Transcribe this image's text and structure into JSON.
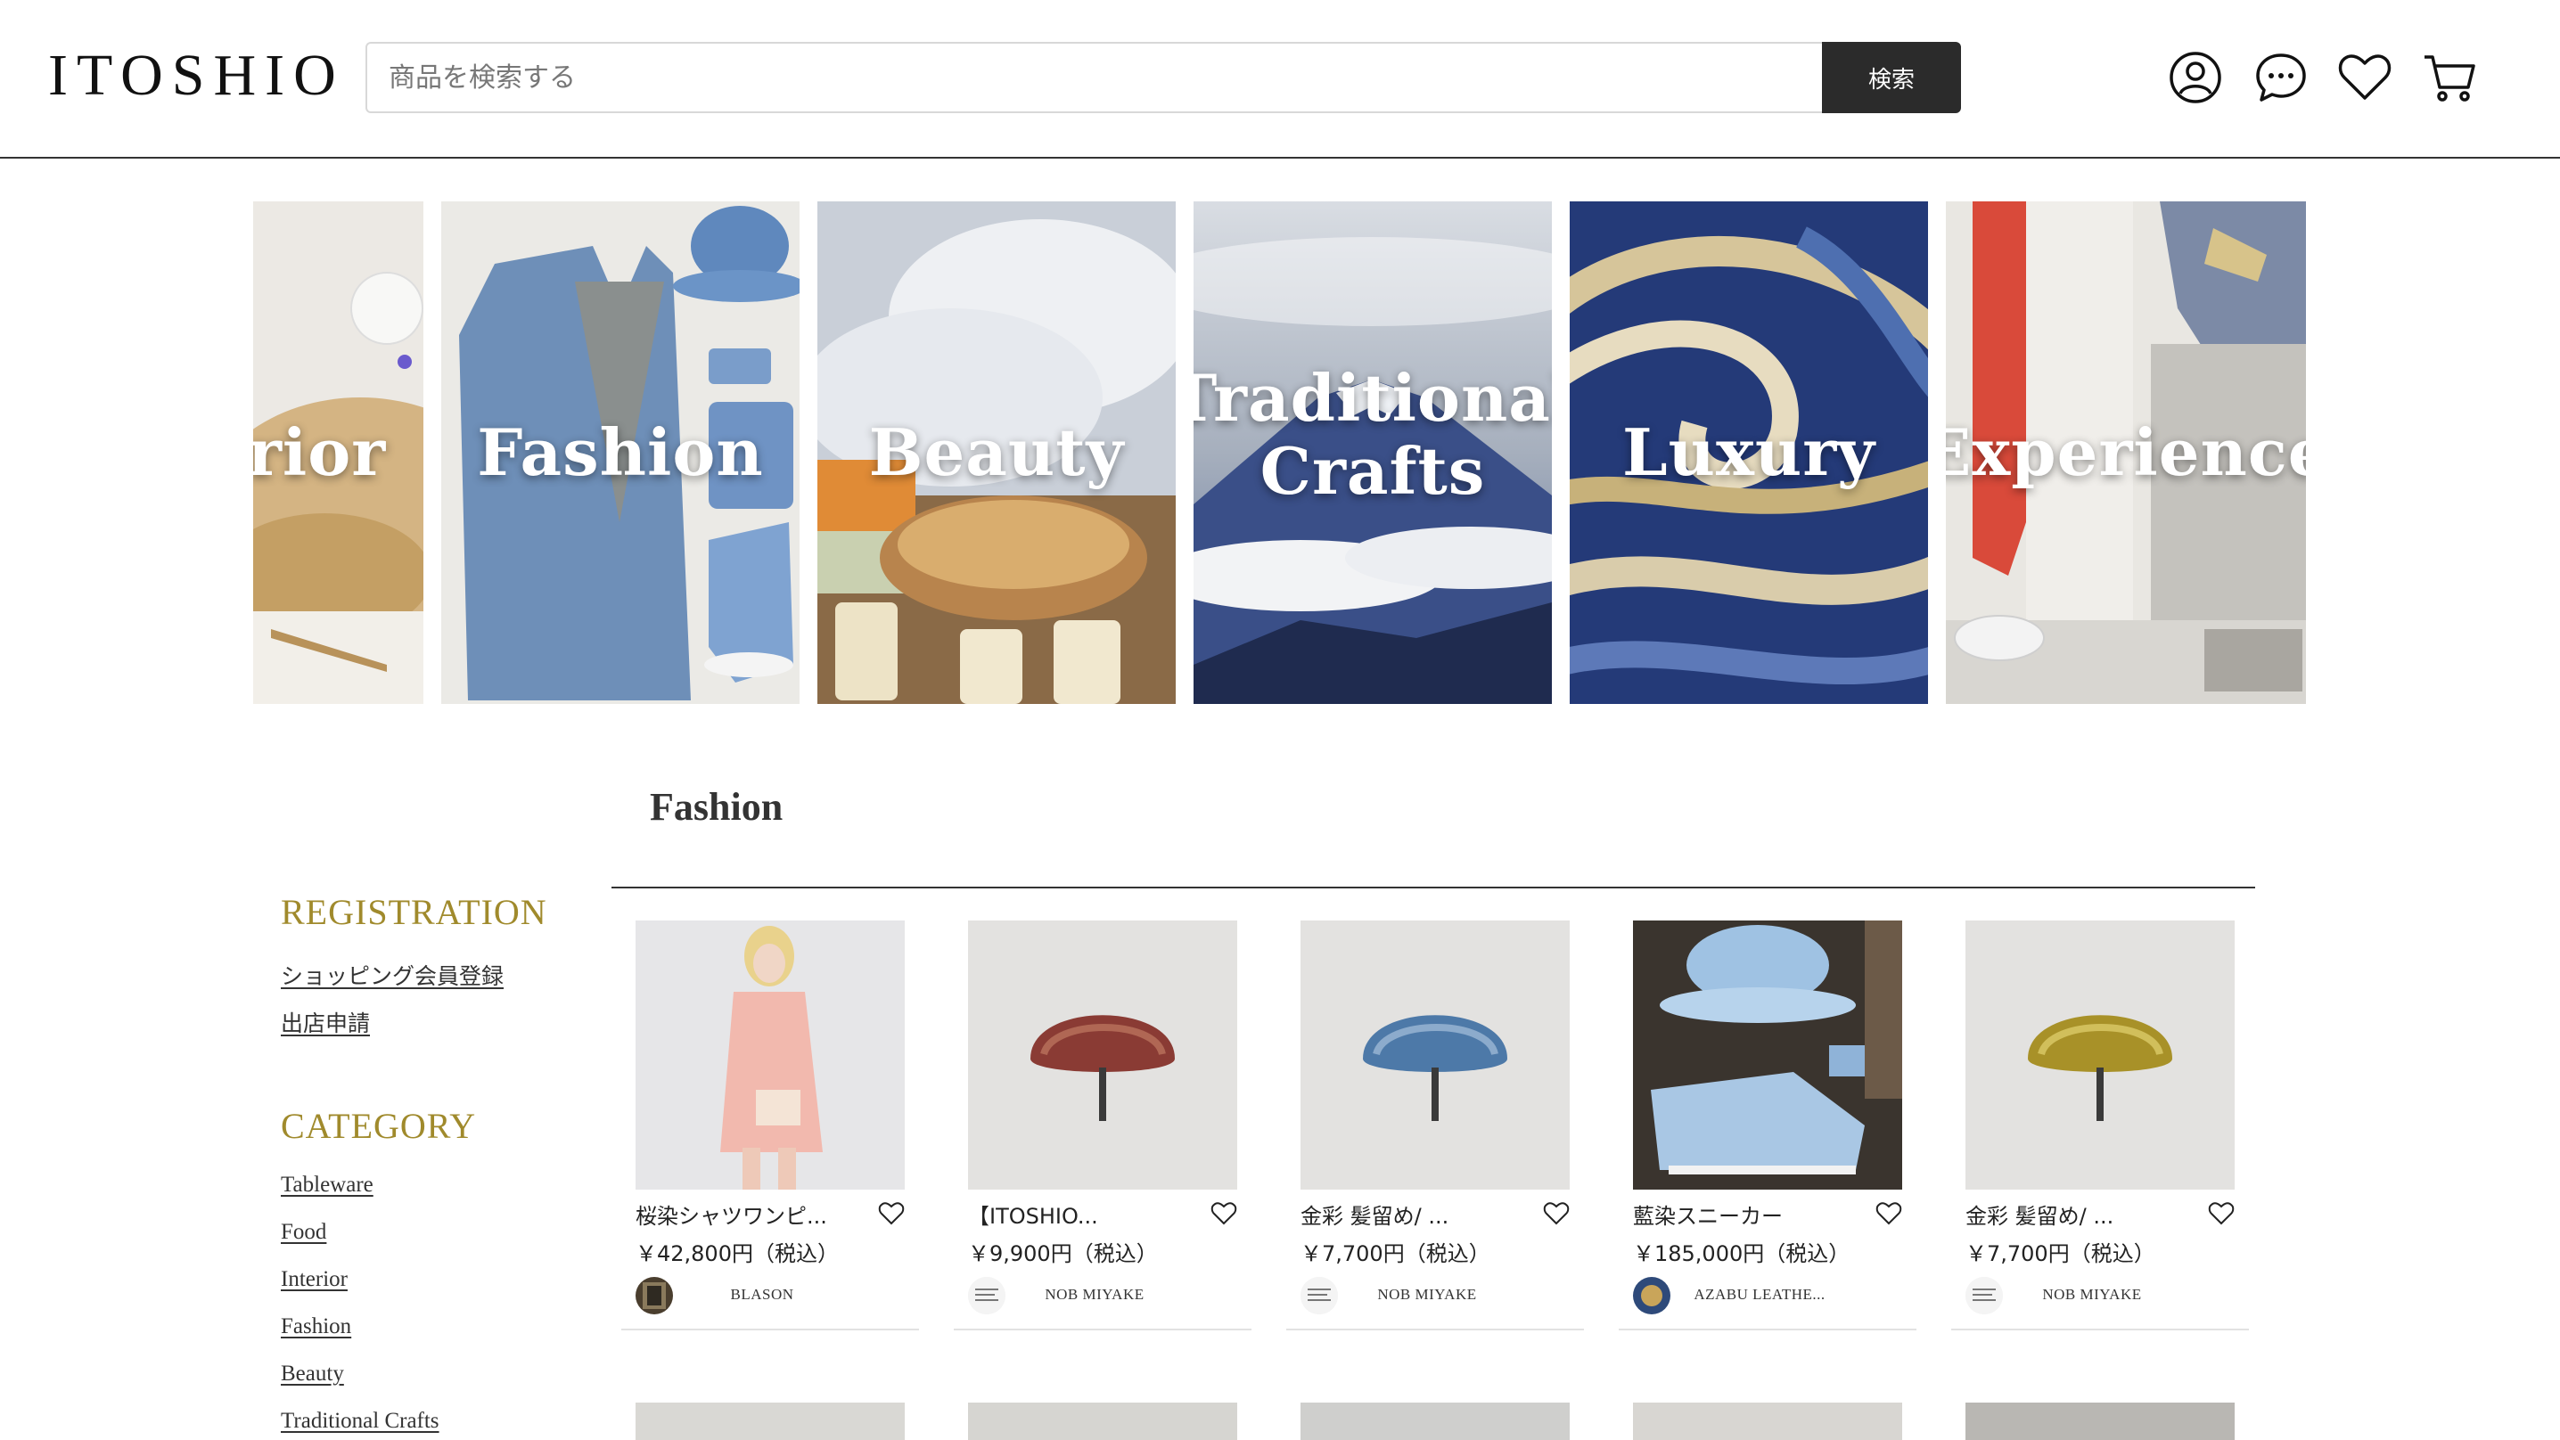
{
  "header": {
    "logo": "ITOSHIO",
    "search_placeholder": "商品を検索する",
    "search_button": "検索",
    "icons": [
      "account-icon",
      "chat-icon",
      "heart-icon",
      "cart-icon"
    ]
  },
  "categories": [
    "rior",
    "Fashion",
    "Beauty",
    "Traditional Crafts",
    "Luxury",
    "Experience"
  ],
  "section_title": "Fashion",
  "sidebar": {
    "registration_heading": "REGISTRATION",
    "registration_links": [
      "ショッピング会員登録",
      "出店申請"
    ],
    "category_heading": "CATEGORY",
    "category_links": [
      "Tableware",
      "Food",
      "Interior",
      "Fashion",
      "Beauty",
      "Traditional Crafts"
    ]
  },
  "products": [
    {
      "name": "桜染シャツワンピ...",
      "price": "￥42,800円（税込）",
      "shop": "BLASON"
    },
    {
      "name": "【ITOSHIO...",
      "price": "￥9,900円（税込）",
      "shop": "NOB MIYAKE"
    },
    {
      "name": "金彩 髪留め/ ...",
      "price": "￥7,700円（税込）",
      "shop": "NOB MIYAKE"
    },
    {
      "name": "藍染スニーカー",
      "price": "￥185,000円（税込）",
      "shop": "AZABU LEATHE..."
    },
    {
      "name": "金彩 髪留め/ ...",
      "price": "￥7,700円（税込）",
      "shop": "NOB MIYAKE"
    }
  ],
  "colors": {
    "accent_gold": "#a08a2c",
    "search_button_bg": "#2b2b2b",
    "text": "#222222"
  }
}
